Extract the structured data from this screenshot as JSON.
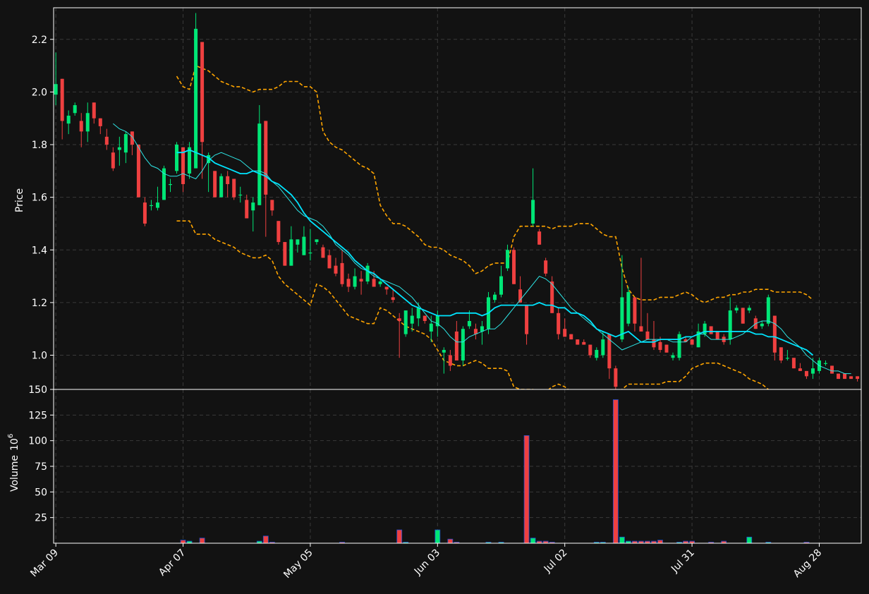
{
  "chart_data": {
    "type": "candlestick",
    "background": "#121212",
    "colors": {
      "up": "#00e676",
      "down": "#ef4040",
      "ma_fast": "#2ee6e6",
      "ma_slow": "#00e5ff",
      "band": "#ffa500",
      "volume_edge": "#1f4fd0",
      "grid": "#3a3a3a",
      "text": "#ffffff"
    },
    "price_panel": {
      "ylabel": "Price",
      "ylim": [
        0.87,
        2.32
      ],
      "yticks": [
        1.0,
        1.2,
        1.4,
        1.6,
        1.8,
        2.0,
        2.2
      ],
      "ytick_labels": [
        "1.0",
        "1.2",
        "1.4",
        "1.6",
        "1.8",
        "2.0",
        "2.2"
      ],
      "grid": true
    },
    "volume_panel": {
      "ylabel": "Volume",
      "yexponent": "6",
      "ylim": [
        0,
        150
      ],
      "yticks": [
        25,
        50,
        75,
        100,
        125,
        150
      ],
      "ytick_labels": [
        "25",
        "50",
        "75",
        "100",
        "125",
        "150"
      ],
      "grid": true
    },
    "x_ticks": [
      {
        "i": 0,
        "label": "Mar 09"
      },
      {
        "i": 20,
        "label": "Apr 07"
      },
      {
        "i": 40,
        "label": "May 05"
      },
      {
        "i": 60,
        "label": "Jun 03"
      },
      {
        "i": 80,
        "label": "Jul 02"
      },
      {
        "i": 100,
        "label": "Jul 31"
      },
      {
        "i": 120,
        "label": "Aug 28"
      }
    ],
    "x_range": [
      -0.35,
      126.6
    ],
    "ohlc": [
      [
        1.99,
        2.15,
        1.95,
        2.03
      ],
      [
        2.05,
        2.05,
        1.82,
        1.89
      ],
      [
        1.88,
        1.93,
        1.84,
        1.91
      ],
      [
        1.92,
        1.96,
        1.91,
        1.95
      ],
      [
        1.89,
        1.92,
        1.79,
        1.85
      ],
      [
        1.85,
        1.96,
        1.81,
        1.92
      ],
      [
        1.96,
        1.96,
        1.88,
        1.9
      ],
      [
        1.9,
        1.9,
        1.84,
        1.87
      ],
      [
        1.83,
        1.86,
        1.78,
        1.8
      ],
      [
        1.77,
        1.79,
        1.7,
        1.71
      ],
      [
        1.78,
        1.83,
        1.72,
        1.79
      ],
      [
        1.77,
        1.85,
        1.73,
        1.84
      ],
      [
        1.85,
        1.85,
        1.76,
        1.8
      ],
      [
        1.8,
        1.8,
        1.6,
        1.6
      ],
      [
        1.58,
        1.6,
        1.49,
        1.5
      ],
      [
        1.57,
        1.59,
        1.55,
        1.57
      ],
      [
        1.56,
        1.64,
        1.55,
        1.58
      ],
      [
        1.59,
        1.72,
        1.59,
        1.71
      ],
      [
        1.65,
        1.67,
        1.62,
        1.65
      ],
      [
        1.7,
        1.81,
        1.69,
        1.8
      ],
      [
        1.79,
        1.79,
        1.62,
        1.65
      ],
      [
        1.69,
        1.81,
        1.67,
        1.79
      ],
      [
        1.71,
        2.3,
        1.71,
        2.24
      ],
      [
        2.19,
        2.19,
        1.67,
        1.81
      ],
      [
        1.73,
        1.77,
        1.62,
        1.76
      ],
      [
        1.7,
        1.7,
        1.6,
        1.6
      ],
      [
        1.6,
        1.69,
        1.6,
        1.68
      ],
      [
        1.68,
        1.7,
        1.6,
        1.65
      ],
      [
        1.67,
        1.67,
        1.59,
        1.6
      ],
      [
        1.61,
        1.64,
        1.58,
        1.61
      ],
      [
        1.59,
        1.61,
        1.52,
        1.52
      ],
      [
        1.55,
        1.6,
        1.47,
        1.58
      ],
      [
        1.57,
        1.95,
        1.57,
        1.88
      ],
      [
        1.89,
        1.89,
        1.45,
        1.61
      ],
      [
        1.59,
        1.59,
        1.53,
        1.55
      ],
      [
        1.51,
        1.51,
        1.42,
        1.43
      ],
      [
        1.43,
        1.43,
        1.34,
        1.34
      ],
      [
        1.34,
        1.49,
        1.34,
        1.44
      ],
      [
        1.42,
        1.44,
        1.39,
        1.44
      ],
      [
        1.38,
        1.49,
        1.38,
        1.45
      ],
      [
        1.39,
        1.48,
        1.36,
        1.39
      ],
      [
        1.43,
        1.44,
        1.42,
        1.44
      ],
      [
        1.41,
        1.42,
        1.37,
        1.37
      ],
      [
        1.38,
        1.4,
        1.33,
        1.33
      ],
      [
        1.34,
        1.37,
        1.3,
        1.31
      ],
      [
        1.35,
        1.4,
        1.26,
        1.27
      ],
      [
        1.29,
        1.31,
        1.24,
        1.26
      ],
      [
        1.26,
        1.33,
        1.25,
        1.3
      ],
      [
        1.29,
        1.32,
        1.23,
        1.28
      ],
      [
        1.28,
        1.35,
        1.27,
        1.34
      ],
      [
        1.29,
        1.32,
        1.26,
        1.26
      ],
      [
        1.27,
        1.29,
        1.26,
        1.28
      ],
      [
        1.26,
        1.26,
        1.23,
        1.25
      ],
      [
        1.22,
        1.25,
        1.2,
        1.21
      ],
      [
        1.14,
        1.16,
        0.99,
        1.13
      ],
      [
        1.08,
        1.17,
        1.07,
        1.17
      ],
      [
        1.12,
        1.18,
        1.09,
        1.15
      ],
      [
        1.14,
        1.2,
        1.11,
        1.18
      ],
      [
        1.15,
        1.15,
        1.12,
        1.13
      ],
      [
        1.09,
        1.15,
        1.05,
        1.12
      ],
      [
        1.11,
        1.17,
        1.07,
        1.15
      ],
      [
        1.01,
        1.03,
        0.93,
        1.02
      ],
      [
        1.0,
        1.02,
        0.94,
        0.96
      ],
      [
        1.09,
        1.13,
        0.98,
        0.98
      ],
      [
        0.98,
        1.11,
        0.96,
        1.1
      ],
      [
        1.11,
        1.17,
        1.1,
        1.13
      ],
      [
        1.1,
        1.12,
        1.06,
        1.08
      ],
      [
        1.09,
        1.13,
        1.04,
        1.11
      ],
      [
        1.1,
        1.24,
        1.08,
        1.22
      ],
      [
        1.21,
        1.24,
        1.2,
        1.23
      ],
      [
        1.23,
        1.34,
        1.22,
        1.3
      ],
      [
        1.33,
        1.42,
        1.32,
        1.4
      ],
      [
        1.4,
        1.41,
        1.27,
        1.27
      ],
      [
        1.25,
        1.3,
        1.2,
        1.2
      ],
      [
        1.19,
        1.19,
        1.04,
        1.08
      ],
      [
        1.5,
        1.71,
        1.49,
        1.59
      ],
      [
        1.47,
        1.48,
        1.42,
        1.42
      ],
      [
        1.36,
        1.37,
        1.3,
        1.31
      ],
      [
        1.28,
        1.3,
        1.16,
        1.16
      ],
      [
        1.16,
        1.18,
        1.06,
        1.08
      ],
      [
        1.1,
        1.14,
        1.07,
        1.07
      ],
      [
        1.08,
        1.08,
        1.06,
        1.06
      ],
      [
        1.06,
        1.06,
        1.04,
        1.04
      ],
      [
        1.05,
        1.06,
        1.04,
        1.04
      ],
      [
        1.04,
        1.04,
        0.99,
        1.0
      ],
      [
        0.99,
        1.03,
        0.98,
        1.02
      ],
      [
        1.0,
        1.09,
        0.99,
        1.06
      ],
      [
        1.08,
        1.08,
        0.91,
        0.95
      ],
      [
        0.95,
        0.96,
        0.87,
        0.88
      ],
      [
        1.06,
        1.38,
        1.05,
        1.22
      ],
      [
        1.12,
        1.26,
        1.11,
        1.24
      ],
      [
        1.22,
        1.22,
        1.09,
        1.12
      ],
      [
        1.11,
        1.37,
        1.09,
        1.09
      ],
      [
        1.09,
        1.16,
        1.07,
        1.06
      ],
      [
        1.06,
        1.13,
        1.02,
        1.03
      ],
      [
        1.05,
        1.07,
        1.01,
        1.02
      ],
      [
        1.04,
        1.04,
        1.01,
        1.01
      ],
      [
        0.99,
        1.01,
        0.98,
        1.0
      ],
      [
        0.99,
        1.09,
        0.98,
        1.08
      ],
      [
        1.06,
        1.07,
        1.05,
        1.05
      ],
      [
        1.06,
        1.06,
        1.04,
        1.04
      ],
      [
        1.03,
        1.12,
        1.03,
        1.09
      ],
      [
        1.08,
        1.13,
        1.07,
        1.12
      ],
      [
        1.11,
        1.11,
        1.08,
        1.08
      ],
      [
        1.09,
        1.09,
        1.06,
        1.06
      ],
      [
        1.07,
        1.08,
        1.04,
        1.05
      ],
      [
        1.06,
        1.22,
        1.04,
        1.17
      ],
      [
        1.17,
        1.19,
        1.16,
        1.18
      ],
      [
        1.18,
        1.18,
        1.12,
        1.12
      ],
      [
        1.17,
        1.19,
        1.16,
        1.18
      ],
      [
        1.14,
        1.15,
        1.1,
        1.1
      ],
      [
        1.11,
        1.13,
        1.1,
        1.12
      ],
      [
        1.12,
        1.23,
        1.11,
        1.22
      ],
      [
        1.15,
        1.15,
        0.98,
        1.01
      ],
      [
        1.03,
        1.03,
        0.97,
        0.98
      ],
      [
        0.99,
        1.02,
        0.98,
        0.99
      ],
      [
        0.99,
        0.99,
        0.95,
        0.95
      ],
      [
        0.95,
        0.97,
        0.94,
        0.94
      ],
      [
        0.94,
        0.94,
        0.91,
        0.92
      ],
      [
        0.93,
        0.99,
        0.91,
        0.95
      ],
      [
        0.94,
        0.99,
        0.93,
        0.98
      ],
      [
        0.97,
        0.98,
        0.96,
        0.97
      ],
      [
        0.96,
        0.96,
        0.93,
        0.93
      ],
      [
        0.93,
        0.93,
        0.91,
        0.91
      ],
      [
        0.93,
        0.93,
        0.91,
        0.91
      ],
      [
        0.92,
        0.92,
        0.91,
        0.91
      ],
      [
        0.92,
        0.92,
        0.9,
        0.91
      ],
      [
        0.92,
        0.92,
        0.89,
        0.9
      ]
    ],
    "volume": [
      [
        20,
        3.0
      ],
      [
        21,
        2.0
      ],
      [
        23,
        5.0
      ],
      [
        32,
        2.0
      ],
      [
        33,
        7.0
      ],
      [
        34,
        1.0
      ],
      [
        45,
        1.0
      ],
      [
        54,
        13.0
      ],
      [
        55,
        1.0
      ],
      [
        60,
        13.0
      ],
      [
        62,
        4.0
      ],
      [
        63,
        1.0
      ],
      [
        68,
        1.0
      ],
      [
        70,
        1.0
      ],
      [
        74,
        105.0
      ],
      [
        75,
        5.0
      ],
      [
        76,
        2.0
      ],
      [
        77,
        2.0
      ],
      [
        78,
        1.0
      ],
      [
        85,
        1.0
      ],
      [
        86,
        1.0
      ],
      [
        88,
        140.0
      ],
      [
        89,
        6.0
      ],
      [
        90,
        2.0
      ],
      [
        91,
        2.0
      ],
      [
        92,
        2.0
      ],
      [
        93,
        2.0
      ],
      [
        94,
        2.0
      ],
      [
        95,
        3.0
      ],
      [
        98,
        1.0
      ],
      [
        99,
        2.0
      ],
      [
        100,
        2.0
      ],
      [
        103,
        1.0
      ],
      [
        105,
        2.0
      ],
      [
        109,
        6.0
      ],
      [
        112,
        1.0
      ],
      [
        118,
        1.0
      ]
    ],
    "series": [
      {
        "kind": "ma_fast",
        "start": 9,
        "values": [
          1.88,
          1.86,
          1.85,
          1.83,
          1.79,
          1.75,
          1.72,
          1.71,
          1.69,
          1.68,
          1.68,
          1.69,
          1.68,
          1.67,
          1.7,
          1.74,
          1.76,
          1.77,
          1.76,
          1.75,
          1.74,
          1.72,
          1.7,
          1.7,
          1.69,
          1.66,
          1.64,
          1.61,
          1.58,
          1.55,
          1.53,
          1.52,
          1.51,
          1.49,
          1.46,
          1.42,
          1.4,
          1.38,
          1.35,
          1.33,
          1.32,
          1.3,
          1.29,
          1.28,
          1.27,
          1.26,
          1.24,
          1.22,
          1.19,
          1.16,
          1.13,
          1.12,
          1.1,
          1.07,
          1.05,
          1.05,
          1.07,
          1.08,
          1.09,
          1.1,
          1.1,
          1.12,
          1.15,
          1.18,
          1.21,
          1.24,
          1.27,
          1.3,
          1.29,
          1.27,
          1.24,
          1.21,
          1.18,
          1.16,
          1.14,
          1.12,
          1.1,
          1.08,
          1.06,
          1.04,
          1.02,
          1.03,
          1.04,
          1.05,
          1.06,
          1.06,
          1.06,
          1.06,
          1.05,
          1.05,
          1.05,
          1.07,
          1.08,
          1.08,
          1.06,
          1.06,
          1.06,
          1.06,
          1.07,
          1.08,
          1.1,
          1.12,
          1.13,
          1.13,
          1.12,
          1.1,
          1.07,
          1.05,
          1.03,
          1.0,
          0.98,
          0.96,
          0.95,
          0.94,
          0.94,
          0.93,
          0.93
        ]
      },
      {
        "kind": "ma_slow",
        "start": 19,
        "values": [
          1.77,
          1.77,
          1.78,
          1.77,
          1.76,
          1.75,
          1.73,
          1.72,
          1.71,
          1.7,
          1.69,
          1.69,
          1.7,
          1.69,
          1.68,
          1.66,
          1.65,
          1.63,
          1.61,
          1.58,
          1.54,
          1.51,
          1.49,
          1.47,
          1.45,
          1.43,
          1.41,
          1.39,
          1.36,
          1.34,
          1.32,
          1.31,
          1.29,
          1.27,
          1.25,
          1.23,
          1.21,
          1.19,
          1.18,
          1.17,
          1.16,
          1.15,
          1.15,
          1.15,
          1.16,
          1.16,
          1.16,
          1.16,
          1.15,
          1.16,
          1.18,
          1.19,
          1.19,
          1.19,
          1.19,
          1.19,
          1.19,
          1.2,
          1.19,
          1.19,
          1.18,
          1.18,
          1.16,
          1.16,
          1.15,
          1.13,
          1.1,
          1.09,
          1.08,
          1.07,
          1.08,
          1.09,
          1.07,
          1.05,
          1.05,
          1.05,
          1.06,
          1.06,
          1.06,
          1.06,
          1.07,
          1.07,
          1.08,
          1.09,
          1.09,
          1.09,
          1.09,
          1.09,
          1.09,
          1.09,
          1.09,
          1.08,
          1.08,
          1.07,
          1.07,
          1.06,
          1.05,
          1.04,
          1.03,
          1.02,
          1.0
        ]
      },
      {
        "kind": "band_upper",
        "start": 19,
        "values": [
          2.06,
          2.02,
          2.01,
          2.1,
          2.09,
          2.08,
          2.06,
          2.04,
          2.03,
          2.02,
          2.02,
          2.01,
          2.0,
          2.01,
          2.01,
          2.01,
          2.02,
          2.04,
          2.04,
          2.04,
          2.02,
          2.02,
          2.0,
          1.85,
          1.81,
          1.79,
          1.78,
          1.76,
          1.74,
          1.72,
          1.71,
          1.69,
          1.57,
          1.53,
          1.5,
          1.5,
          1.49,
          1.47,
          1.45,
          1.42,
          1.41,
          1.41,
          1.4,
          1.38,
          1.37,
          1.36,
          1.34,
          1.31,
          1.32,
          1.34,
          1.35,
          1.35,
          1.35,
          1.45,
          1.49,
          1.49,
          1.49,
          1.49,
          1.49,
          1.48,
          1.49,
          1.49,
          1.49,
          1.5,
          1.5,
          1.5,
          1.48,
          1.46,
          1.45,
          1.45,
          1.33,
          1.25,
          1.22,
          1.21,
          1.21,
          1.21,
          1.22,
          1.22,
          1.22,
          1.23,
          1.24,
          1.23,
          1.21,
          1.2,
          1.21,
          1.22,
          1.22,
          1.23,
          1.23,
          1.24,
          1.24,
          1.25,
          1.25,
          1.25,
          1.24,
          1.24,
          1.24,
          1.24,
          1.24,
          1.23,
          1.21
        ]
      },
      {
        "kind": "band_lower",
        "start": 19,
        "values": [
          1.51,
          1.51,
          1.51,
          1.46,
          1.46,
          1.46,
          1.44,
          1.43,
          1.42,
          1.41,
          1.39,
          1.38,
          1.37,
          1.37,
          1.38,
          1.36,
          1.3,
          1.27,
          1.25,
          1.23,
          1.21,
          1.19,
          1.27,
          1.26,
          1.24,
          1.21,
          1.18,
          1.15,
          1.14,
          1.13,
          1.12,
          1.12,
          1.18,
          1.17,
          1.15,
          1.13,
          1.11,
          1.1,
          1.09,
          1.08,
          1.06,
          1.02,
          0.98,
          0.97,
          0.96,
          0.96,
          0.97,
          0.98,
          0.97,
          0.95,
          0.95,
          0.95,
          0.94,
          0.88,
          0.87,
          0.87,
          0.87,
          0.86,
          0.86,
          0.88,
          0.89,
          0.88,
          0.86,
          0.85,
          0.83,
          0.82,
          0.82,
          0.82,
          0.82,
          0.86,
          0.87,
          0.89,
          0.89,
          0.89,
          0.89,
          0.89,
          0.89,
          0.9,
          0.9,
          0.9,
          0.92,
          0.95,
          0.96,
          0.97,
          0.97,
          0.97,
          0.96,
          0.95,
          0.94,
          0.93,
          0.91,
          0.9,
          0.89,
          0.87,
          0.86,
          0.84,
          0.82,
          0.81,
          0.8,
          0.79,
          0.78
        ]
      }
    ]
  }
}
